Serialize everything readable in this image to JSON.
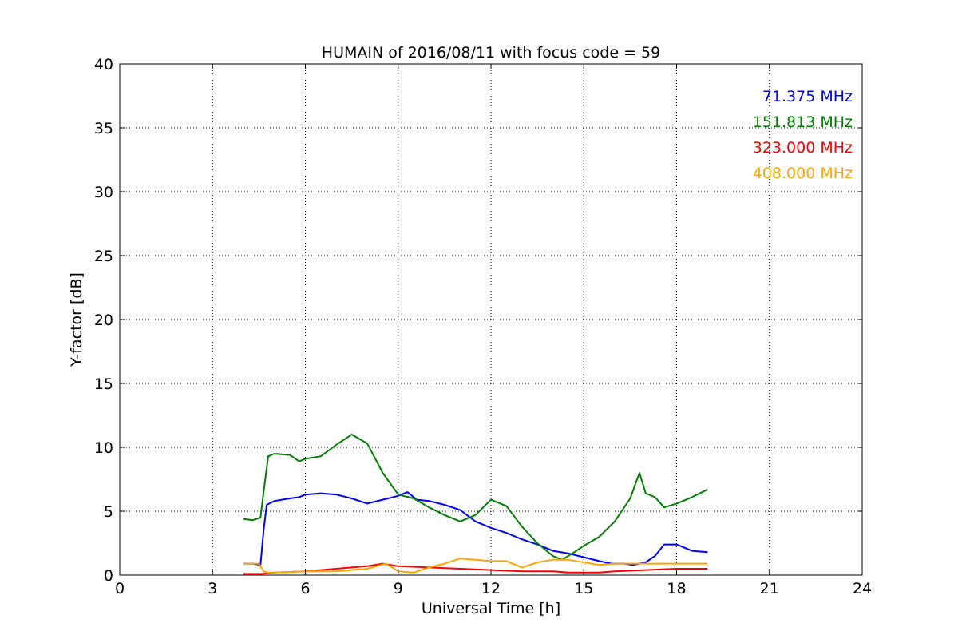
{
  "chart_data": {
    "type": "line",
    "title": "HUMAIN of 2016/08/11 with focus code = 59",
    "xlabel": "Universal Time [h]",
    "ylabel": "Y-factor [dB]",
    "xlim": [
      0,
      24
    ],
    "ylim": [
      0,
      40
    ],
    "xticks": [
      0,
      3,
      6,
      9,
      12,
      15,
      18,
      21,
      24
    ],
    "yticks": [
      0,
      5,
      10,
      15,
      20,
      25,
      30,
      35,
      40
    ],
    "grid": true,
    "legend_position": "top-right",
    "series": [
      {
        "name": "71.375 MHz",
        "color": "#0000ff",
        "x": [
          4.0,
          4.3,
          4.55,
          4.65,
          4.75,
          5.0,
          5.5,
          5.8,
          6.0,
          6.5,
          7.0,
          7.5,
          8.0,
          8.5,
          9.0,
          9.3,
          9.6,
          10.0,
          10.5,
          11.0,
          11.5,
          12.0,
          12.5,
          13.0,
          13.5,
          14.0,
          14.5,
          15.0,
          15.5,
          15.9,
          16.3,
          16.6,
          17.0,
          17.3,
          17.6,
          18.0,
          18.5,
          19.0
        ],
        "y": [
          0.9,
          0.9,
          0.8,
          3.5,
          5.5,
          5.8,
          6.0,
          6.1,
          6.3,
          6.4,
          6.3,
          6.0,
          5.6,
          5.9,
          6.2,
          6.5,
          5.9,
          5.8,
          5.5,
          5.1,
          4.2,
          3.7,
          3.3,
          2.8,
          2.4,
          1.9,
          1.7,
          1.4,
          1.1,
          0.9,
          0.9,
          0.8,
          1.0,
          1.5,
          2.4,
          2.4,
          1.9,
          1.8
        ]
      },
      {
        "name": "151.813 MHz",
        "color": "#008000",
        "x": [
          4.0,
          4.3,
          4.55,
          4.65,
          4.8,
          5.0,
          5.5,
          5.8,
          6.0,
          6.5,
          7.0,
          7.5,
          8.0,
          8.5,
          9.0,
          9.5,
          10.0,
          10.5,
          11.0,
          11.5,
          12.0,
          12.5,
          13.0,
          13.5,
          14.0,
          14.3,
          14.7,
          15.0,
          15.5,
          16.0,
          16.5,
          16.8,
          17.0,
          17.3,
          17.6,
          18.0,
          18.5,
          19.0
        ],
        "y": [
          4.4,
          4.3,
          4.5,
          6.5,
          9.3,
          9.5,
          9.4,
          8.9,
          9.1,
          9.3,
          10.2,
          11.0,
          10.3,
          8.0,
          6.3,
          6.0,
          5.3,
          4.7,
          4.2,
          4.7,
          5.9,
          5.4,
          3.8,
          2.5,
          1.5,
          1.2,
          1.8,
          2.3,
          3.0,
          4.2,
          6.0,
          8.0,
          6.4,
          6.1,
          5.3,
          5.6,
          6.1,
          6.7
        ]
      },
      {
        "name": "323.000 MHz",
        "color": "#ff0000",
        "x": [
          4.0,
          4.6,
          5.0,
          6.0,
          7.0,
          8.0,
          8.5,
          9.0,
          10.0,
          11.0,
          12.0,
          13.0,
          14.0,
          14.5,
          15.0,
          15.5,
          16.0,
          17.0,
          18.0,
          19.0
        ],
        "y": [
          0.1,
          0.1,
          0.2,
          0.3,
          0.5,
          0.7,
          0.9,
          0.7,
          0.6,
          0.5,
          0.4,
          0.3,
          0.3,
          0.2,
          0.2,
          0.2,
          0.3,
          0.4,
          0.5,
          0.5
        ]
      },
      {
        "name": "408.000 MHz",
        "color": "#ffa500",
        "x": [
          4.0,
          4.5,
          4.65,
          4.8,
          5.0,
          6.0,
          7.0,
          8.0,
          8.6,
          9.0,
          9.5,
          10.0,
          10.5,
          11.0,
          11.5,
          12.0,
          12.5,
          13.0,
          13.5,
          14.0,
          14.5,
          15.0,
          15.5,
          16.0,
          17.0,
          18.0,
          19.0
        ],
        "y": [
          0.9,
          0.9,
          0.3,
          0.2,
          0.2,
          0.3,
          0.3,
          0.5,
          0.9,
          0.3,
          0.2,
          0.6,
          0.9,
          1.3,
          1.2,
          1.1,
          1.1,
          0.6,
          1.0,
          1.2,
          1.2,
          1.0,
          0.8,
          0.9,
          0.9,
          0.9,
          0.9
        ]
      }
    ]
  }
}
